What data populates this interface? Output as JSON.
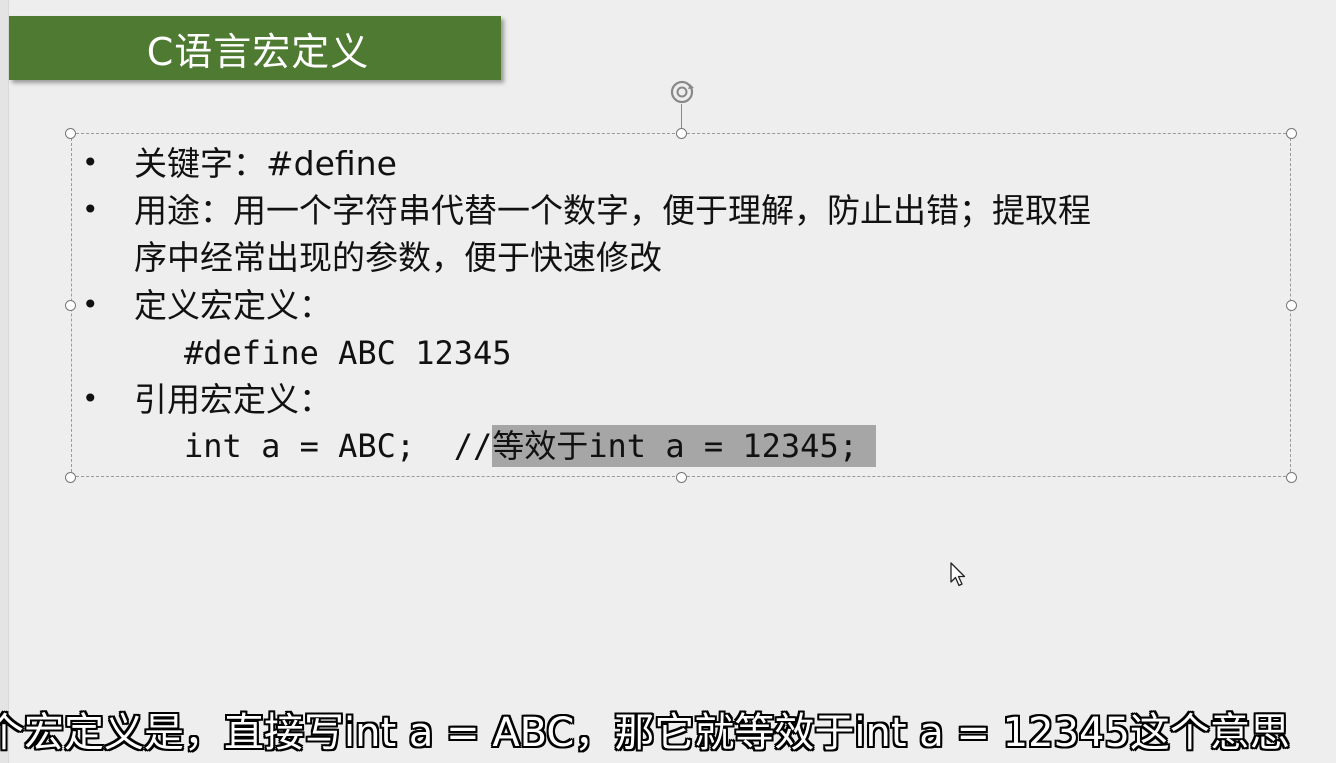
{
  "slide": {
    "title": "C语言宏定义",
    "title_bg_color": "#4e7a32"
  },
  "content": {
    "bullets": [
      {
        "text": "关键字：#define"
      },
      {
        "line1": "用途：用一个字符串代替一个数字，便于理解，防止出错；提取程",
        "line2": "序中经常出现的参数，便于快速修改"
      },
      {
        "text": "定义宏定义：",
        "code": "#define ABC 12345"
      },
      {
        "text": "引用宏定义：",
        "code": "int a = ABC;  //",
        "code_highlight": "等效于int a = 12345;"
      }
    ]
  },
  "subtitle": {
    "text": "个宏定义是，直接写int a = ABC，那它就等效于int a = 12345这个意思"
  },
  "icons": {
    "bullet": "•",
    "rotate": "rotate-handle-icon",
    "cursor": "mouse-pointer-icon"
  }
}
